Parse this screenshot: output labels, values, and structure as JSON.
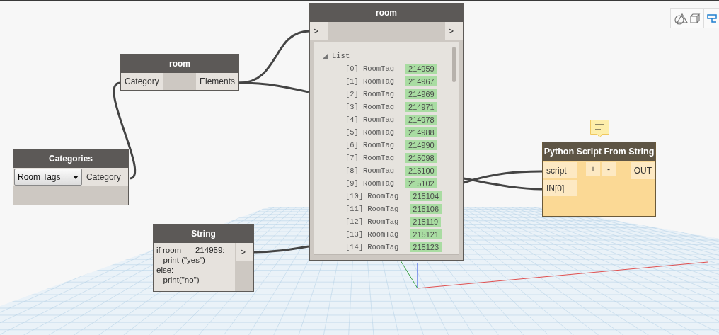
{
  "nodes": [
    {
      "kind": "selector",
      "title": "room",
      "inputs": [
        "Category"
      ],
      "outputs": [
        "Elements"
      ]
    },
    {
      "kind": "dropdown",
      "title": "Categories",
      "value": "Room Tags",
      "outputs": [
        "Category"
      ]
    },
    {
      "kind": "watch",
      "title": "room",
      "input": ">",
      "output": ">",
      "list_label": "List",
      "items": [
        {
          "index": "[0]",
          "type": "RoomTag",
          "id": "214959"
        },
        {
          "index": "[1]",
          "type": "RoomTag",
          "id": "214967"
        },
        {
          "index": "[2]",
          "type": "RoomTag",
          "id": "214969"
        },
        {
          "index": "[3]",
          "type": "RoomTag",
          "id": "214971"
        },
        {
          "index": "[4]",
          "type": "RoomTag",
          "id": "214978"
        },
        {
          "index": "[5]",
          "type": "RoomTag",
          "id": "214988"
        },
        {
          "index": "[6]",
          "type": "RoomTag",
          "id": "214990"
        },
        {
          "index": "[7]",
          "type": "RoomTag",
          "id": "215098"
        },
        {
          "index": "[8]",
          "type": "RoomTag",
          "id": "215100"
        },
        {
          "index": "[9]",
          "type": "RoomTag",
          "id": "215102"
        },
        {
          "index": "[10]",
          "type": "RoomTag",
          "id": "215104"
        },
        {
          "index": "[11]",
          "type": "RoomTag",
          "id": "215106"
        },
        {
          "index": "[12]",
          "type": "RoomTag",
          "id": "215119"
        },
        {
          "index": "[13]",
          "type": "RoomTag",
          "id": "215121"
        },
        {
          "index": "[14]",
          "type": "RoomTag",
          "id": "215123"
        }
      ]
    },
    {
      "kind": "string",
      "title": "String",
      "lines": [
        "if room == 214959:",
        "   print (\"yes\")",
        "else:",
        "   print(\"no\")"
      ],
      "output": ">"
    },
    {
      "kind": "python",
      "title": "Python Script From String",
      "inputs": [
        "script",
        "IN[0]"
      ],
      "add": "+",
      "remove": "-",
      "outputs": [
        "OUT"
      ]
    }
  ]
}
